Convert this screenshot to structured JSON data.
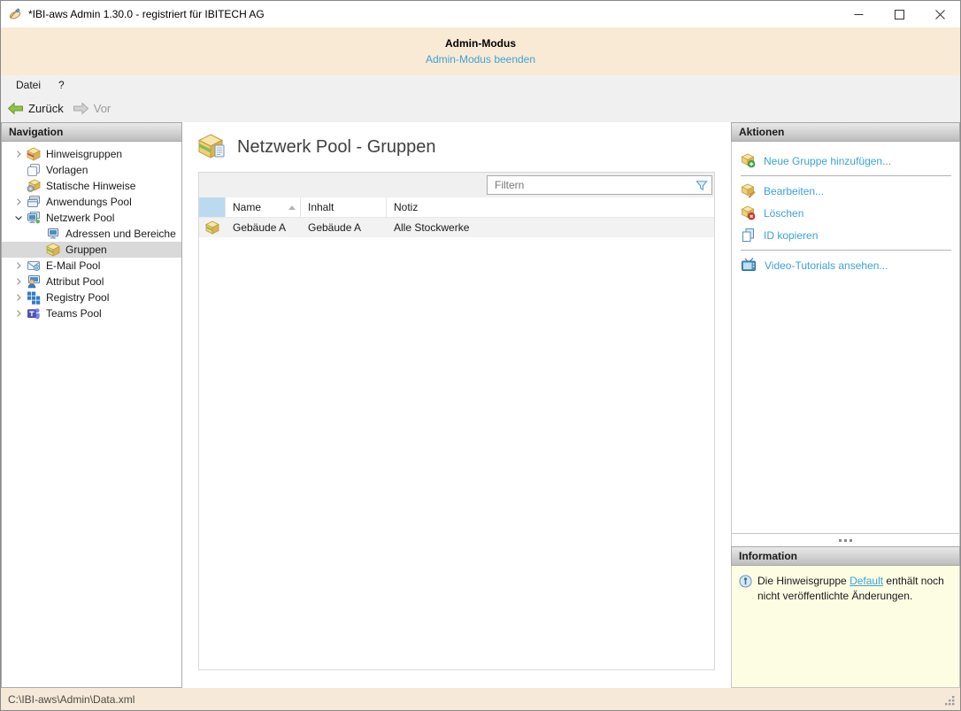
{
  "window": {
    "title": "*IBI-aws Admin 1.30.0 - registriert für IBITECH AG",
    "icon": "app-icon",
    "controls": {
      "minimize": "minimize-icon",
      "maximize": "maximize-icon",
      "close": "close-icon"
    }
  },
  "admin_banner": {
    "title": "Admin-Modus",
    "link": "Admin-Modus beenden"
  },
  "menu": {
    "items": [
      {
        "label": "Datei"
      },
      {
        "label": "?"
      }
    ]
  },
  "toolbar": {
    "back_label": "Zurück",
    "back_icon": "arrow-left-icon",
    "back_enabled": true,
    "forward_label": "Vor",
    "forward_icon": "arrow-right-icon",
    "forward_enabled": false
  },
  "navigation": {
    "header": "Navigation",
    "items": [
      {
        "label": "Hinweisgruppen",
        "icon": "notice-groups-icon",
        "expander": "collapsed",
        "level": 0,
        "selected": false
      },
      {
        "label": "Vorlagen",
        "icon": "templates-icon",
        "expander": "none",
        "level": 0,
        "selected": false
      },
      {
        "label": "Statische Hinweise",
        "icon": "static-notices-icon",
        "expander": "none",
        "level": 0,
        "selected": false
      },
      {
        "label": "Anwendungs Pool",
        "icon": "application-pool-icon",
        "expander": "collapsed",
        "level": 0,
        "selected": false
      },
      {
        "label": "Netzwerk Pool",
        "icon": "network-pool-icon",
        "expander": "expanded",
        "level": 0,
        "selected": false
      },
      {
        "label": "Adressen und Bereiche",
        "icon": "addresses-icon",
        "expander": "none",
        "level": 1,
        "selected": false
      },
      {
        "label": "Gruppen",
        "icon": "groups-icon",
        "expander": "none",
        "level": 1,
        "selected": true
      },
      {
        "label": "E-Mail Pool",
        "icon": "email-pool-icon",
        "expander": "collapsed",
        "level": 0,
        "selected": false
      },
      {
        "label": "Attribut Pool",
        "icon": "attribute-pool-icon",
        "expander": "collapsed",
        "level": 0,
        "selected": false
      },
      {
        "label": "Registry Pool",
        "icon": "registry-pool-icon",
        "expander": "collapsed",
        "level": 0,
        "selected": false
      },
      {
        "label": "Teams Pool",
        "icon": "teams-pool-icon",
        "expander": "collapsed",
        "level": 0,
        "selected": false
      }
    ]
  },
  "main": {
    "title": "Netzwerk Pool - Gruppen",
    "title_icon": "network-group-icon",
    "filter": {
      "placeholder": "Filtern",
      "icon": "filter-funnel-icon"
    },
    "table": {
      "columns": [
        "Name",
        "Inhalt",
        "Notiz"
      ],
      "sort_column": "Name",
      "sort_direction": "ascending",
      "rows": [
        {
          "icon": "group-cube-icon",
          "name": "Gebäude A",
          "inhalt": "Gebäude A",
          "notiz": "Alle Stockwerke"
        }
      ]
    }
  },
  "actions": {
    "header": "Aktionen",
    "items": [
      {
        "label": "Neue Gruppe hinzufügen...",
        "icon": "group-add-icon"
      },
      {
        "label": "Bearbeiten...",
        "icon": "group-edit-icon"
      },
      {
        "label": "Löschen",
        "icon": "group-delete-icon"
      },
      {
        "label": "ID kopieren",
        "icon": "copy-icon"
      },
      {
        "label": "Video-Tutorials ansehen...",
        "icon": "tv-icon"
      }
    ]
  },
  "information": {
    "header": "Information",
    "icon": "info-icon",
    "text_before": "Die Hinweisgruppe ",
    "link": "Default",
    "text_after": " enthält noch nicht veröffentlichte Änderungen."
  },
  "statusbar": {
    "path": "C:\\IBI-aws\\Admin\\Data.xml"
  },
  "colors": {
    "link_blue": "#3aa3d6",
    "banner_bg": "#f9ead6",
    "info_bg": "#fdfde3",
    "status_bg": "#f6e9d7",
    "selected_tree": "#d9d9d9",
    "header_gradient_top": "#e9e9e9",
    "header_gradient_bottom": "#bdbdbd"
  }
}
